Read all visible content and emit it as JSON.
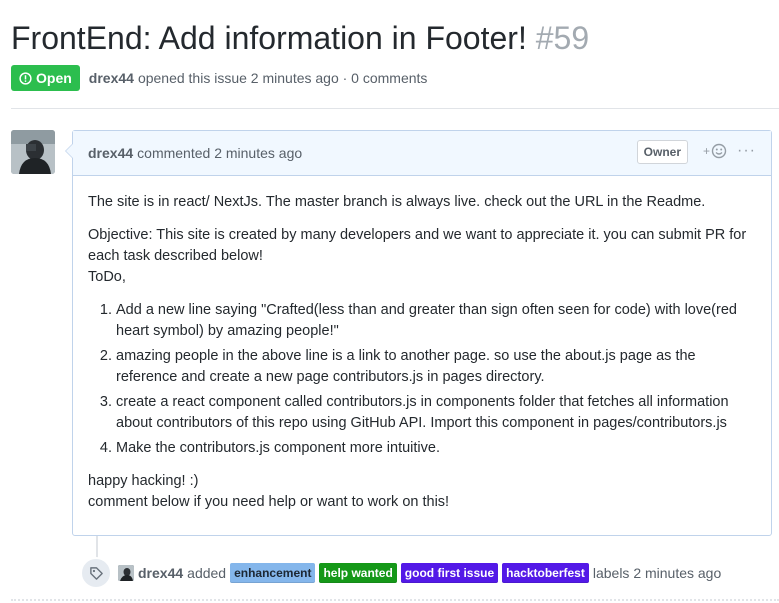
{
  "issue": {
    "title": "FrontEnd: Add information in Footer!",
    "number": "#59",
    "state": "Open",
    "author": "drex44",
    "opened_text": "opened this issue 2 minutes ago · 0 comments"
  },
  "comment": {
    "author": "drex44",
    "action_text": "commented 2 minutes ago",
    "owner_badge": "Owner",
    "reaction_plus": "+",
    "more": "···",
    "paragraph_1": "The site is in react/ NextJs. The master branch is always live. check out the URL in the Readme.",
    "objective_line_1": "Objective: This site is created by many developers and we want to appreciate it. you can submit PR for each task described below!",
    "objective_line_2": "ToDo,",
    "todo_items": [
      "Add a new line saying \"Crafted(less than and greater than sign often seen for code) with love(red heart symbol) by amazing people!\"",
      "amazing people in the above line is a link to another page. so use the about.js page as the reference and create a new page contributors.js in pages directory.",
      "create a react component called contributors.js in components folder that fetches all information about contributors of this repo using GitHub API. Import this component in pages/contributors.js",
      "Make the contributors.js component more intuitive."
    ],
    "closing_line_1": "happy hacking! :)",
    "closing_line_2": "comment below if you need help or want to work on this!"
  },
  "label_event": {
    "author": "drex44",
    "added_text": "added",
    "suffix_text": "labels 2 minutes ago",
    "labels": [
      {
        "name": "enhancement",
        "bg": "#84b6eb",
        "fg": "#1c2733"
      },
      {
        "name": "help wanted",
        "bg": "#159818",
        "fg": "#ffffff"
      },
      {
        "name": "good first issue",
        "bg": "#5319e7",
        "fg": "#ffffff"
      },
      {
        "name": "hacktoberfest",
        "bg": "#5319e7",
        "fg": "#ffffff"
      }
    ]
  },
  "colors": {
    "open_green": "#2cbe4e",
    "comment_border": "#c0d3eb",
    "comment_header_bg": "#f1f8ff"
  }
}
